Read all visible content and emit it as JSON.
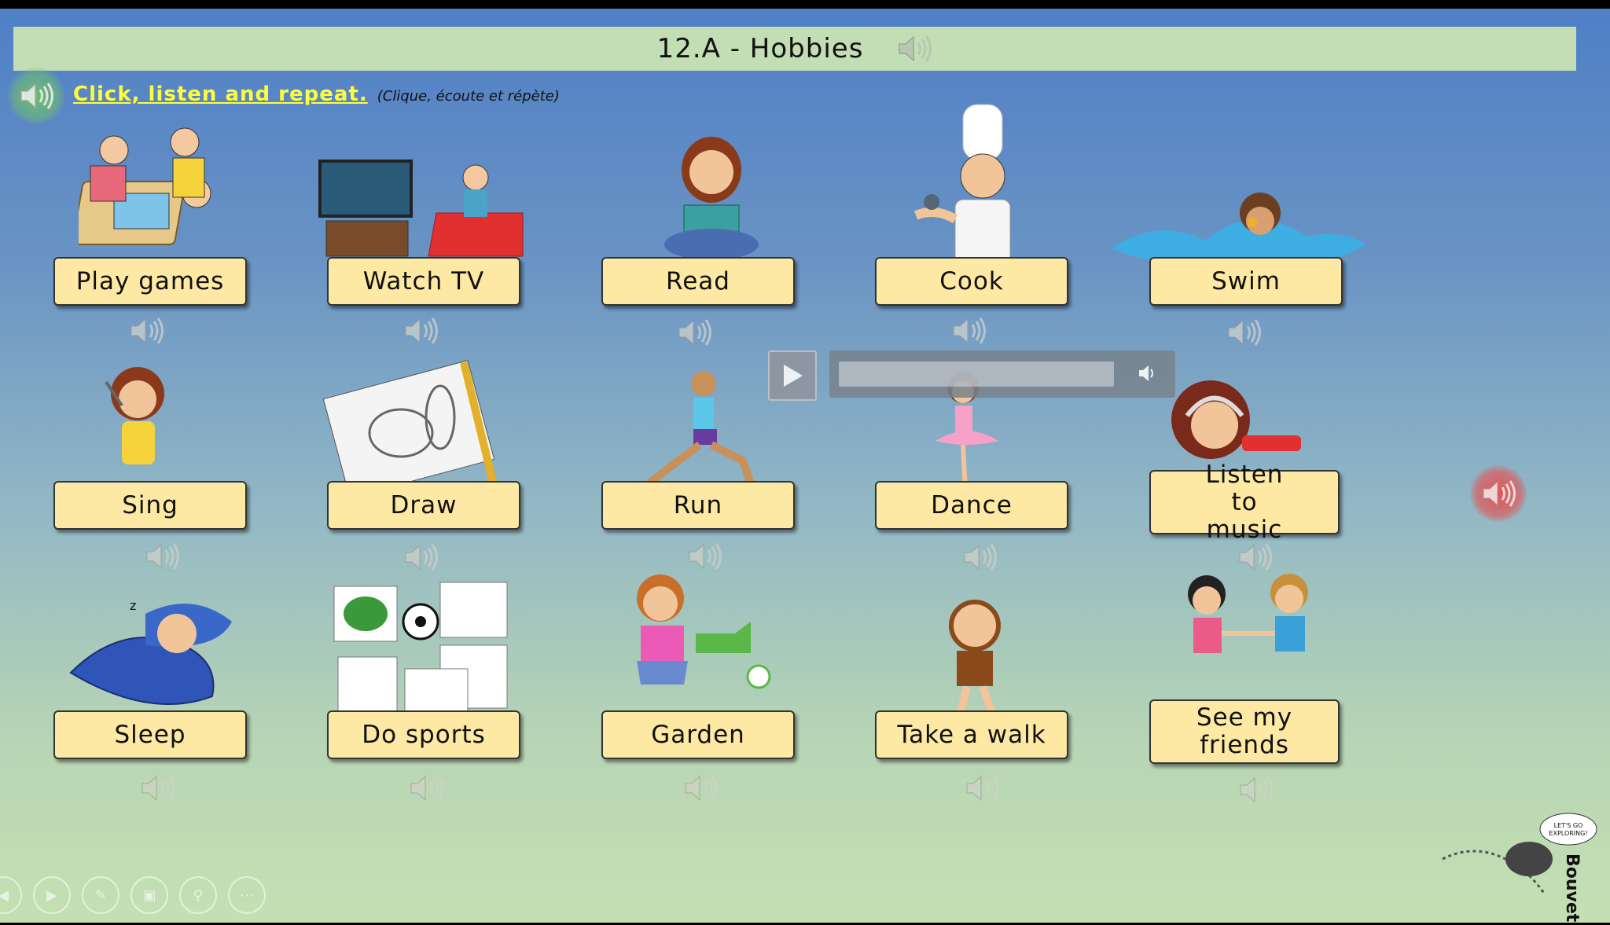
{
  "title": "12.A - Hobbies",
  "instruction": {
    "main": "Click, listen and repeat.",
    "sub": "(Clique, écoute et répète)"
  },
  "items": [
    {
      "label": "Play games",
      "icon": "board-game-icon"
    },
    {
      "label": "Watch TV",
      "icon": "tv-icon"
    },
    {
      "label": "Read",
      "icon": "book-icon"
    },
    {
      "label": "Cook",
      "icon": "chef-icon"
    },
    {
      "label": "Swim",
      "icon": "swimmer-icon"
    },
    {
      "label": "Sing",
      "icon": "microphone-icon"
    },
    {
      "label": "Draw",
      "icon": "sketchbook-icon"
    },
    {
      "label": "Run",
      "icon": "runner-icon"
    },
    {
      "label": "Dance",
      "icon": "ballerina-icon"
    },
    {
      "label": "Listen to music",
      "icon": "headphones-icon"
    },
    {
      "label": "Sleep",
      "icon": "pillow-icon"
    },
    {
      "label": "Do sports",
      "icon": "sports-icon"
    },
    {
      "label": "Garden",
      "icon": "watering-can-icon"
    },
    {
      "label": "Take a walk",
      "icon": "walking-boy-icon"
    },
    {
      "label": "See my friends",
      "icon": "friends-icon"
    }
  ],
  "logo": {
    "text": "LET'S GO EXPLORING!",
    "brand": "Bouvet"
  },
  "colors": {
    "title_bar": "#c3deb4",
    "label_bg": "#fde9a4",
    "instruction": "#ffff3a"
  }
}
